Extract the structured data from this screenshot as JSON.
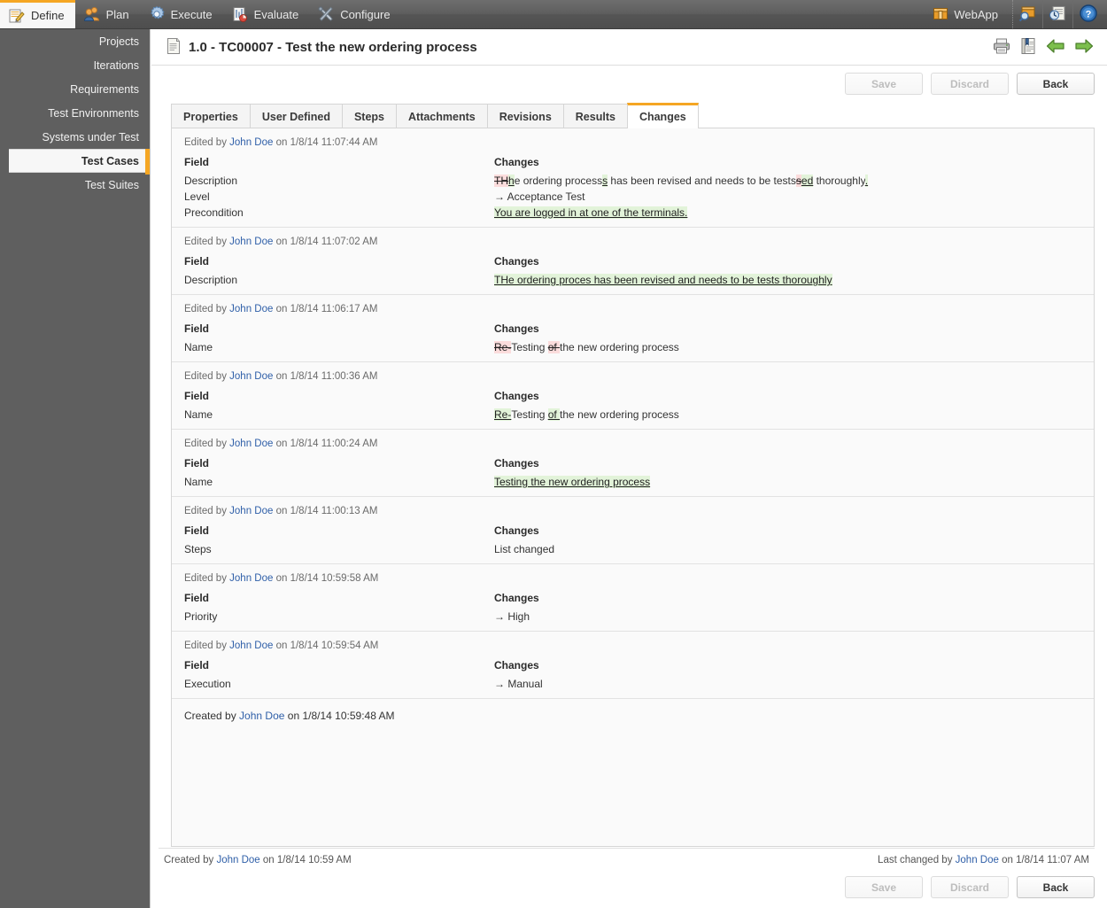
{
  "topnav": {
    "items": [
      {
        "label": "Define",
        "icon": "notepad-pencil-icon",
        "active": true
      },
      {
        "label": "Plan",
        "icon": "users-icon",
        "active": false
      },
      {
        "label": "Execute",
        "icon": "gear-icon",
        "active": false
      },
      {
        "label": "Evaluate",
        "icon": "report-chart-icon",
        "active": false
      },
      {
        "label": "Configure",
        "icon": "tools-icon",
        "active": false
      }
    ],
    "webapp_label": "WebApp",
    "webapp_icon": "box-icon",
    "tools": [
      {
        "icon": "package-search-icon"
      },
      {
        "icon": "history-document-icon"
      },
      {
        "icon": "help-question-icon"
      }
    ]
  },
  "sidebar": {
    "items": [
      {
        "label": "Projects",
        "active": false
      },
      {
        "label": "Iterations",
        "active": false
      },
      {
        "label": "Requirements",
        "active": false
      },
      {
        "label": "Test Environments",
        "active": false
      },
      {
        "label": "Systems under Test",
        "active": false
      },
      {
        "label": "Test Cases",
        "active": true
      },
      {
        "label": "Test Suites",
        "active": false
      }
    ]
  },
  "page": {
    "title": "1.0 - TC00007 - Test the new ordering process",
    "title_icon": "document-icon",
    "head_icons": [
      {
        "icon": "printer-icon"
      },
      {
        "icon": "report-icon"
      },
      {
        "icon": "arrow-left-green-icon"
      },
      {
        "icon": "arrow-right-green-icon"
      }
    ]
  },
  "buttons": {
    "save": "Save",
    "discard": "Discard",
    "back": "Back"
  },
  "tabs": [
    {
      "label": "Properties",
      "active": false
    },
    {
      "label": "User Defined",
      "active": false
    },
    {
      "label": "Steps",
      "active": false
    },
    {
      "label": "Attachments",
      "active": false
    },
    {
      "label": "Revisions",
      "active": false
    },
    {
      "label": "Results",
      "active": false
    },
    {
      "label": "Changes",
      "active": true
    }
  ],
  "table_headers": {
    "field": "Field",
    "changes": "Changes"
  },
  "entries": [
    {
      "prefix": "Edited by",
      "user": "John Doe",
      "on": "on",
      "timestamp": "1/8/14 11:07:44 AM",
      "rows": [
        {
          "field": "Description",
          "parts": [
            {
              "t": "TH",
              "k": "del"
            },
            {
              "t": "h",
              "k": "ins"
            },
            {
              "t": "e ordering process",
              "k": "eq"
            },
            {
              "t": "s",
              "k": "ins"
            },
            {
              "t": " has been revised and needs to be tests",
              "k": "eq"
            },
            {
              "t": "s",
              "k": "del"
            },
            {
              "t": "ed",
              "k": "ins"
            },
            {
              "t": " thoroughly",
              "k": "eq"
            },
            {
              "t": ".",
              "k": "ins"
            }
          ]
        },
        {
          "field": "Level",
          "parts": [
            {
              "t": "→ Acceptance Test",
              "k": "eq"
            }
          ]
        },
        {
          "field": "Precondition",
          "parts": [
            {
              "t": "You are logged in at one of the terminals.",
              "k": "ins"
            }
          ]
        }
      ]
    },
    {
      "prefix": "Edited by",
      "user": "John Doe",
      "on": "on",
      "timestamp": "1/8/14 11:07:02 AM",
      "rows": [
        {
          "field": "Description",
          "parts": [
            {
              "t": "THe ordering proces has been revised and needs to be tests thoroughly",
              "k": "ins"
            }
          ]
        }
      ]
    },
    {
      "prefix": "Edited by",
      "user": "John Doe",
      "on": "on",
      "timestamp": "1/8/14 11:06:17 AM",
      "rows": [
        {
          "field": "Name",
          "parts": [
            {
              "t": "Re-",
              "k": "del"
            },
            {
              "t": "Testing ",
              "k": "eq"
            },
            {
              "t": "of ",
              "k": "del"
            },
            {
              "t": "the new ordering process",
              "k": "eq"
            }
          ]
        }
      ]
    },
    {
      "prefix": "Edited by",
      "user": "John Doe",
      "on": "on",
      "timestamp": "1/8/14 11:00:36 AM",
      "rows": [
        {
          "field": "Name",
          "parts": [
            {
              "t": "Re-",
              "k": "ins"
            },
            {
              "t": "Testing ",
              "k": "eq"
            },
            {
              "t": "of ",
              "k": "ins"
            },
            {
              "t": "the new ordering process",
              "k": "eq"
            }
          ]
        }
      ]
    },
    {
      "prefix": "Edited by",
      "user": "John Doe",
      "on": "on",
      "timestamp": "1/8/14 11:00:24 AM",
      "rows": [
        {
          "field": "Name",
          "parts": [
            {
              "t": "Testing the new ordering process",
              "k": "ins"
            }
          ]
        }
      ]
    },
    {
      "prefix": "Edited by",
      "user": "John Doe",
      "on": "on",
      "timestamp": "1/8/14 11:00:13 AM",
      "rows": [
        {
          "field": "Steps",
          "parts": [
            {
              "t": "List changed",
              "k": "eq"
            }
          ]
        }
      ]
    },
    {
      "prefix": "Edited by",
      "user": "John Doe",
      "on": "on",
      "timestamp": "1/8/14 10:59:58 AM",
      "rows": [
        {
          "field": "Priority",
          "parts": [
            {
              "t": "→ High",
              "k": "eq"
            }
          ]
        }
      ]
    },
    {
      "prefix": "Edited by",
      "user": "John Doe",
      "on": "on",
      "timestamp": "1/8/14 10:59:54 AM",
      "rows": [
        {
          "field": "Execution",
          "parts": [
            {
              "t": "→ Manual",
              "k": "eq"
            }
          ]
        }
      ]
    }
  ],
  "created_entry": {
    "prefix": "Created by",
    "user": "John Doe",
    "on": "on",
    "timestamp": "1/8/14 10:59:48 AM"
  },
  "footer": {
    "created_prefix": "Created by",
    "created_user": "John Doe",
    "created_on": "on",
    "created_timestamp": "1/8/14 10:59 AM",
    "changed_prefix": "Last changed by",
    "changed_user": "John Doe",
    "changed_on": "on",
    "changed_timestamp": "1/8/14 11:07 AM"
  },
  "colors": {
    "accent": "#f5a623",
    "sidebar_bg": "#5f5f5f",
    "link": "#2f5fa8",
    "insert_bg": "#e2f3d9",
    "delete_bg": "#fbdcdc"
  }
}
